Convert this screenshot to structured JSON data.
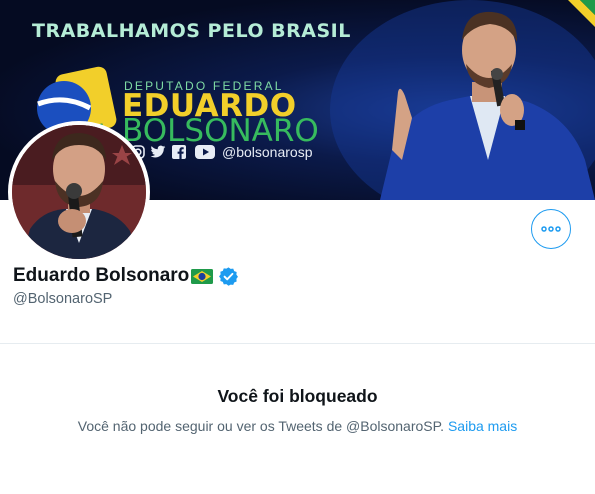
{
  "banner": {
    "slogan": "TRABALHAMOS PELO BRASIL",
    "subtitle": "DEPUTADO FEDERAL",
    "name_first": "EDUARDO",
    "name_last": "BOLSONARO",
    "social_handle": "@bolsonarosp",
    "social_icons": [
      "instagram-icon",
      "twitter-icon",
      "facebook-icon",
      "youtube-icon"
    ]
  },
  "profile": {
    "display_name": "Eduardo Bolsonaro",
    "username": "@BolsonaroSP",
    "badges": [
      "brazil-flag-emoji",
      "verified-badge-icon"
    ]
  },
  "blocked": {
    "title": "Você foi bloqueado",
    "message": "Você não pode seguir ou ver os Tweets de @BolsonaroSP.",
    "link_label": "Saiba mais"
  },
  "colors": {
    "accent": "#1d9bf0",
    "text_primary": "#0f1419",
    "text_secondary": "#536471",
    "banner_bg": "#0b1a4a"
  }
}
